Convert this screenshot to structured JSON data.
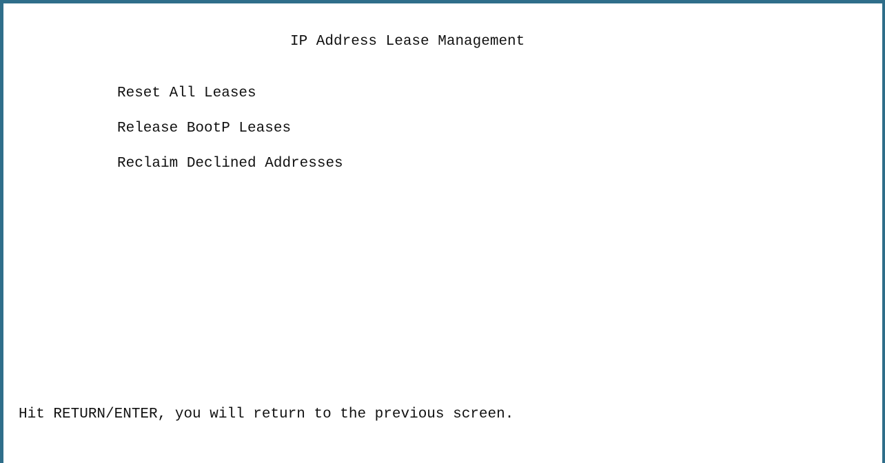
{
  "screen": {
    "title": "IP Address Lease Management",
    "menu_items": [
      {
        "label": "Reset All Leases"
      },
      {
        "label": "Release BootP Leases"
      },
      {
        "label": "Reclaim Declined Addresses"
      }
    ],
    "footer_hint": "Hit RETURN/ENTER, you will return to the previous screen."
  },
  "colors": {
    "frame": "#2f6e8a",
    "background": "#ffffff",
    "text": "#111111"
  }
}
